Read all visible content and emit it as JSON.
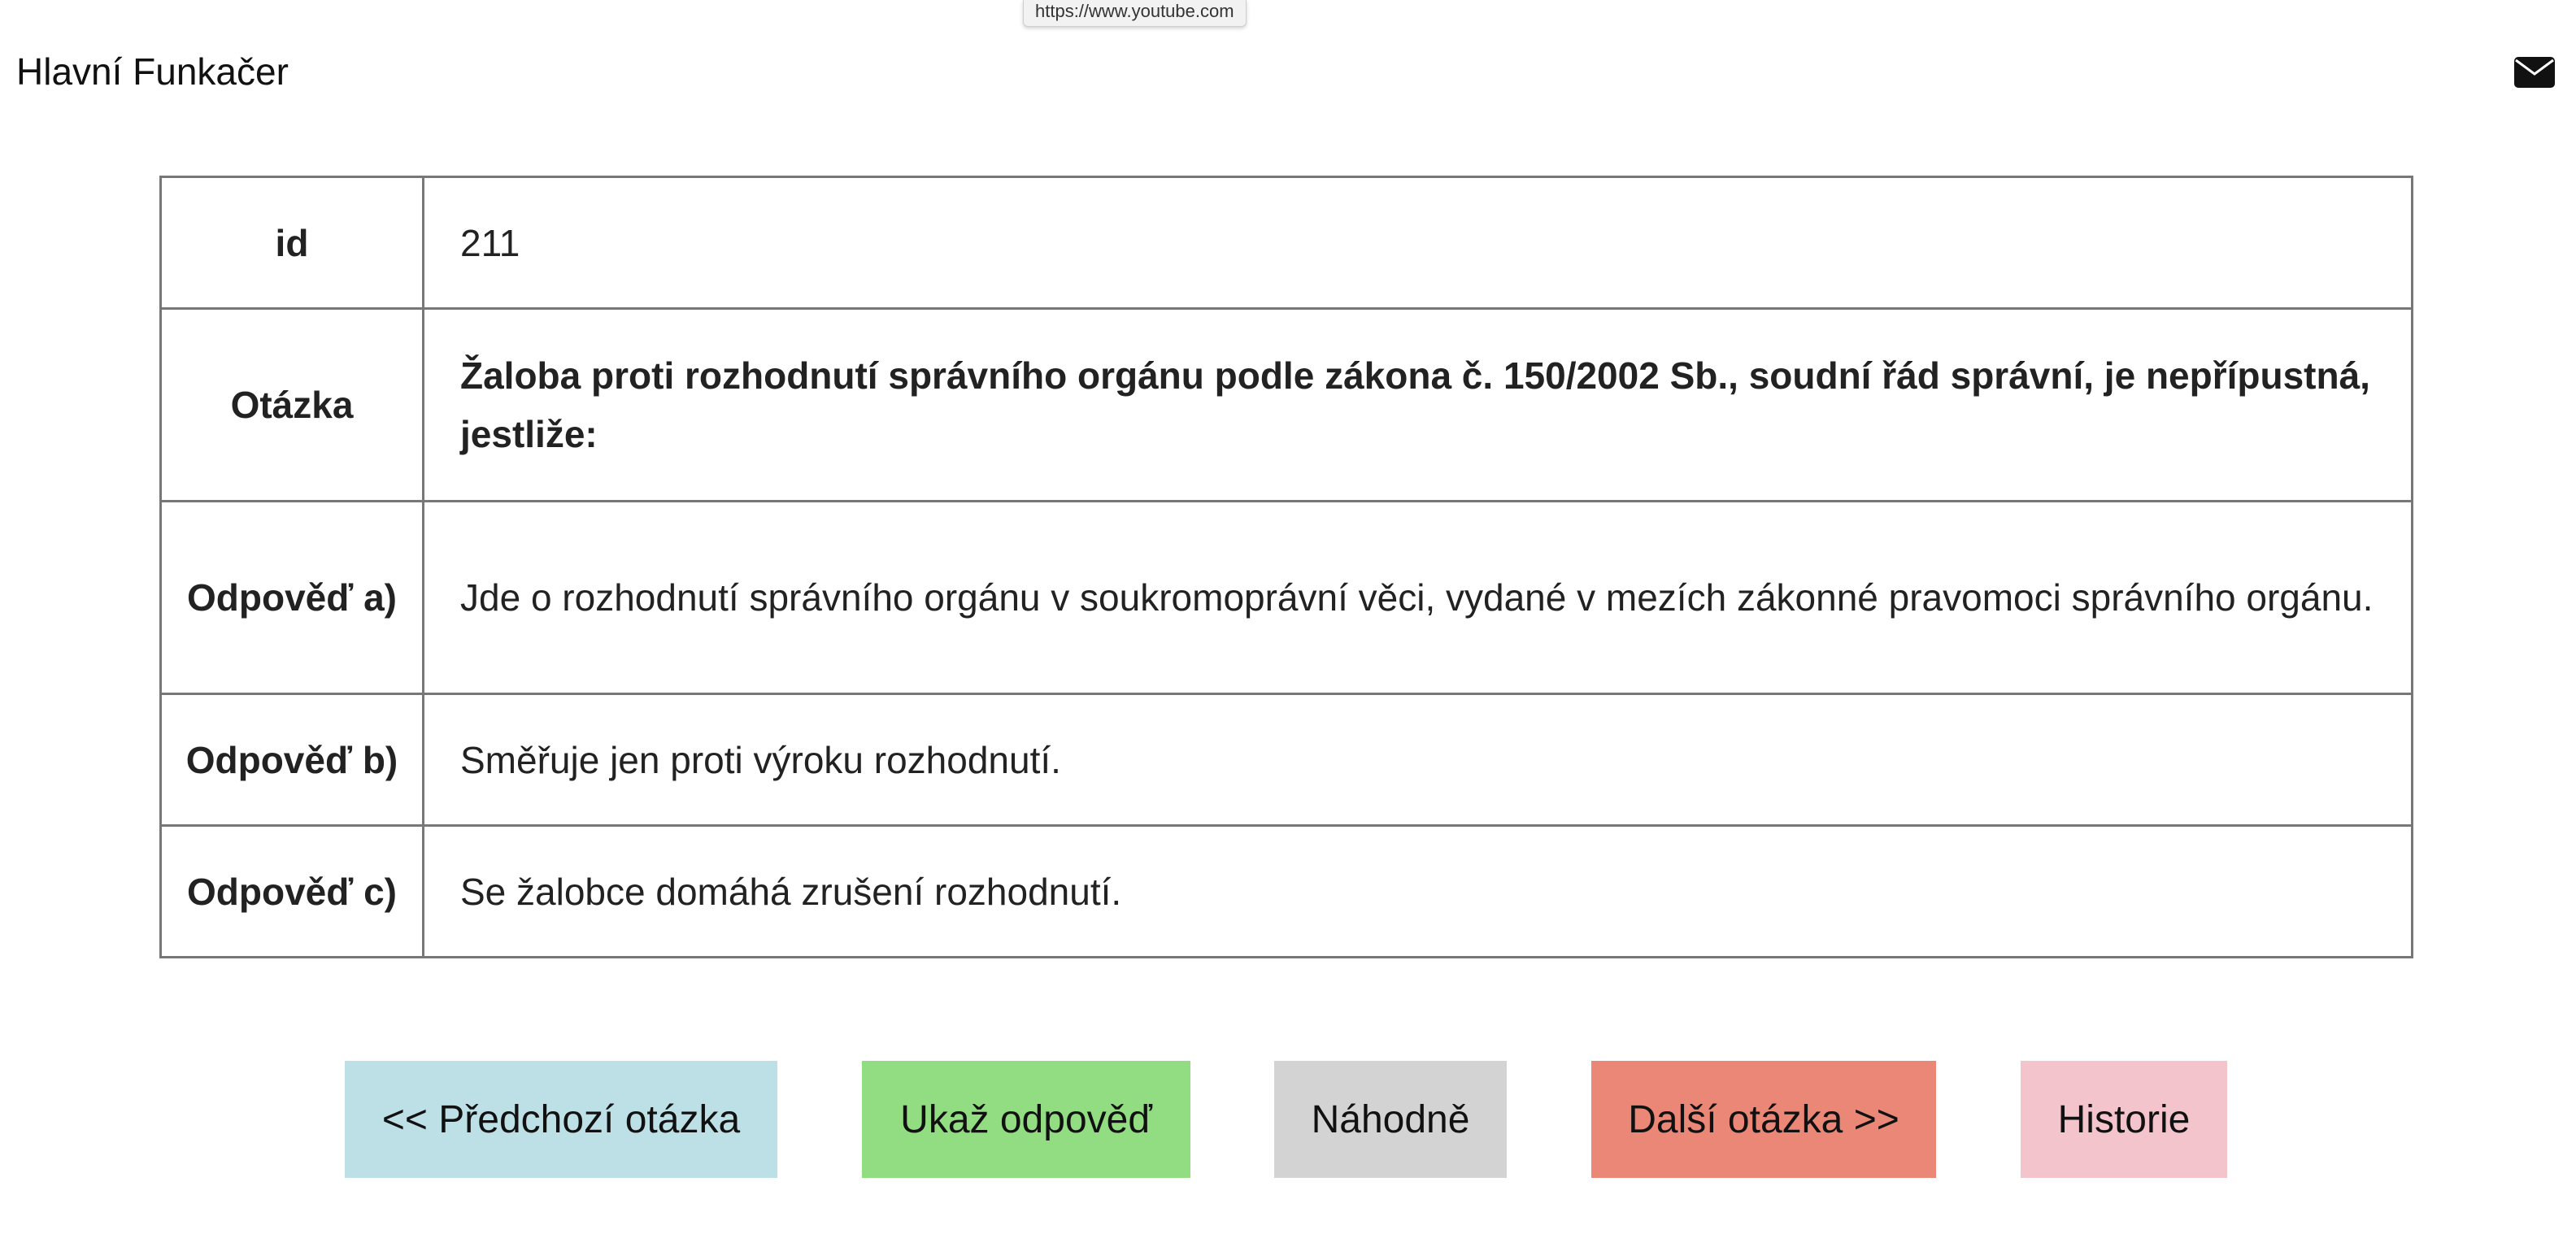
{
  "browser": {
    "status_url": "https://www.youtube.com"
  },
  "header": {
    "brand": "Hlavní Funkačer",
    "mail_icon": "envelope-icon"
  },
  "question": {
    "id_label": "id",
    "id_value": "211",
    "question_label": "Otázka",
    "question_text": "Žaloba proti rozhodnutí správního orgánu podle zákona č. 150/2002 Sb., soudní řád správní, je nepřípustná, jestliže:",
    "answers": [
      {
        "label": "Odpověď a)",
        "text": "Jde o rozhodnutí správního orgánu v soukromoprávní věci, vydané v mezích zákonné pravomoci správního orgánu."
      },
      {
        "label": "Odpověď b)",
        "text": "Směřuje jen proti výroku rozhodnutí."
      },
      {
        "label": "Odpověď c)",
        "text": "Se žalobce domáhá zrušení rozhodnutí."
      }
    ]
  },
  "buttons": {
    "prev": "<< Předchozí otázka",
    "show": "Ukaž odpověď",
    "random": "Náhodně",
    "next": "Další otázka >>",
    "history": "Historie"
  },
  "colors": {
    "prev": "#bde0e6",
    "show": "#92dc82",
    "random": "#d3d3d3",
    "next": "#ea8777",
    "history": "#f4c4cd",
    "table_border": "#777777"
  }
}
